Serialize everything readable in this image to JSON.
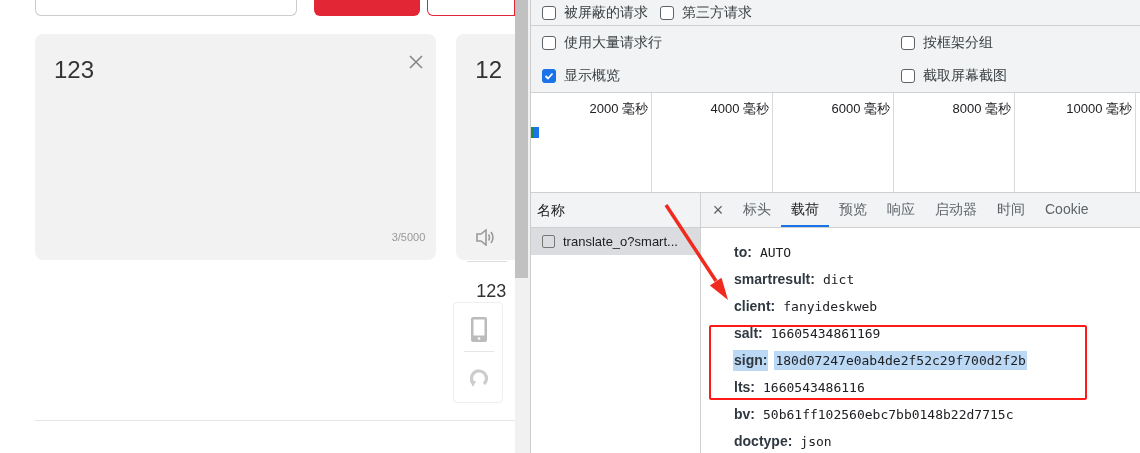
{
  "translator": {
    "source_text": "123",
    "char_count": "3/5000",
    "result_heading": "12",
    "result_text": "123"
  },
  "devtools": {
    "filter_rows": [
      [
        {
          "label": "被屏蔽的请求",
          "checked": false
        },
        {
          "label": "第三方请求",
          "checked": false
        }
      ],
      [
        {
          "label": "使用大量请求行",
          "checked": false
        },
        {
          "label": "按框架分组",
          "checked": false
        }
      ],
      [
        {
          "label": "显示概览",
          "checked": true
        },
        {
          "label": "截取屏幕截图",
          "checked": false
        }
      ]
    ],
    "timeline_ticks": [
      "2000 毫秒",
      "4000 毫秒",
      "6000 毫秒",
      "8000 毫秒",
      "10000 毫秒"
    ],
    "requests_header": "名称",
    "requests": [
      {
        "name": "translate_o?smart...",
        "selected": true,
        "checked": false
      }
    ],
    "close": "×",
    "tabs": [
      {
        "label": "标头",
        "selected": false
      },
      {
        "label": "载荷",
        "selected": true
      },
      {
        "label": "预览",
        "selected": false
      },
      {
        "label": "响应",
        "selected": false
      },
      {
        "label": "启动器",
        "selected": false
      },
      {
        "label": "时间",
        "selected": false
      },
      {
        "label": "Cookie",
        "selected": false
      }
    ],
    "payload": [
      {
        "key": "to:",
        "value": "AUTO",
        "highlighted": false
      },
      {
        "key": "smartresult:",
        "value": "dict",
        "highlighted": false
      },
      {
        "key": "client:",
        "value": "fanyideskweb",
        "highlighted": false
      },
      {
        "key": "salt:",
        "value": "16605434861169",
        "highlighted": false
      },
      {
        "key": "sign:",
        "value": "180d07247e0ab4de2f52c29f700d2f2b",
        "highlighted": true
      },
      {
        "key": "lts:",
        "value": "1660543486116",
        "highlighted": false
      },
      {
        "key": "bv:",
        "value": "50b61ff102560ebc7bb0148b22d7715c",
        "highlighted": false
      },
      {
        "key": "doctype:",
        "value": "json",
        "highlighted": false
      }
    ]
  }
}
